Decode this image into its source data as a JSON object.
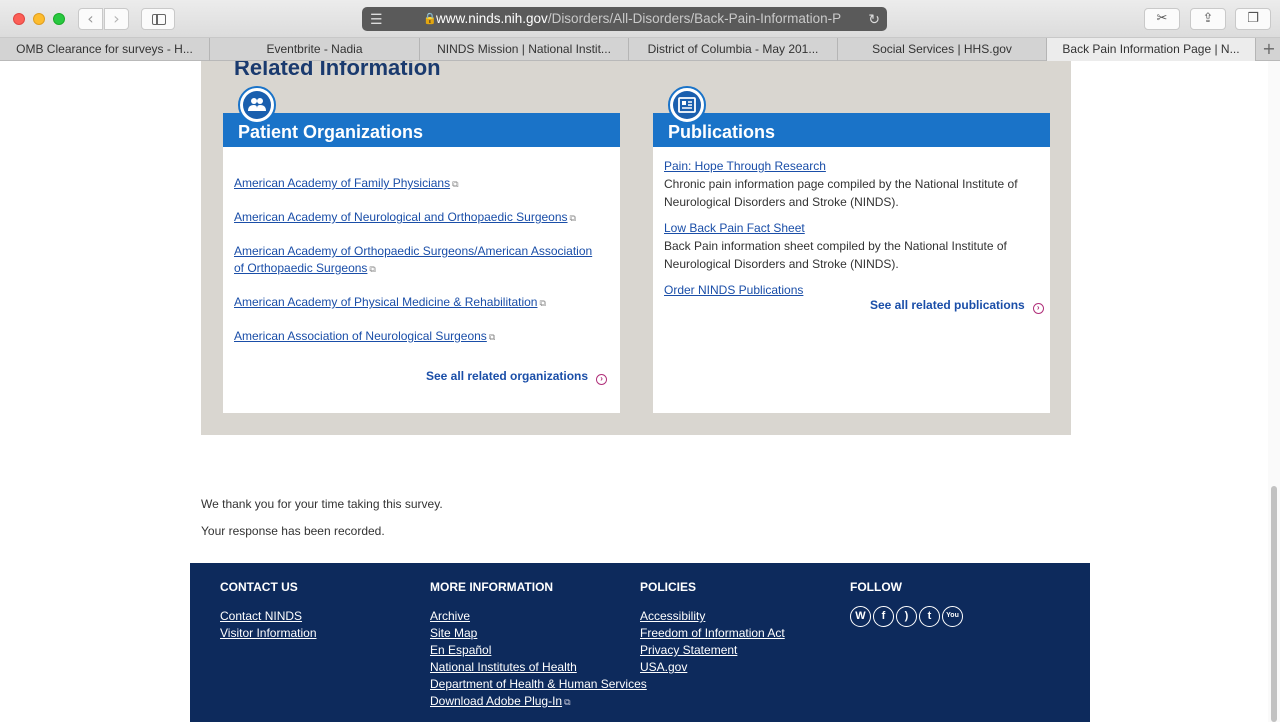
{
  "browser": {
    "url_domain": "www.ninds.nih.gov",
    "url_path": "/Disorders/All-Disorders/Back-Pain-Information-P",
    "tabs": [
      {
        "label": "OMB Clearance for surveys - H..."
      },
      {
        "label": "Eventbrite - Nadia"
      },
      {
        "label": "NINDS Mission | National Instit..."
      },
      {
        "label": "District of Columbia - May 201..."
      },
      {
        "label": "Social Services | HHS.gov"
      },
      {
        "label": "Back Pain Information Page | N..."
      }
    ],
    "new_tab": "+"
  },
  "related": {
    "title": "Related Information",
    "patient_orgs": {
      "title": "Patient Organizations",
      "links": [
        {
          "label": "American Academy of Family Physicians"
        },
        {
          "label": "American Academy of Neurological and Orthopaedic Surgeons"
        },
        {
          "label": "American Academy of Orthopaedic Surgeons/American Association of Orthopaedic Surgeons"
        },
        {
          "label": "American Academy of Physical Medicine & Rehabilitation"
        },
        {
          "label": "American Association of Neurological Surgeons"
        }
      ],
      "see_all": "See all related organizations"
    },
    "publications": {
      "title": "Publications",
      "items": [
        {
          "title": "Pain: Hope Through Research",
          "desc": "Chronic pain information page compiled by the National Institute of Neurological Disorders and Stroke (NINDS)."
        },
        {
          "title": "Low Back Pain Fact Sheet",
          "desc": "Back Pain information sheet compiled by the National Institute of Neurological Disorders and Stroke (NINDS)."
        }
      ],
      "order": "Order NINDS Publications",
      "see_all": "See all related publications"
    }
  },
  "survey": {
    "thanks": "We thank you for your time taking this survey.",
    "recorded": "Your response has been recorded."
  },
  "footer": {
    "contact": {
      "title": "CONTACT US",
      "links": [
        "Contact NINDS",
        "Visitor Information"
      ]
    },
    "more": {
      "title": "MORE INFORMATION",
      "links": [
        "Archive",
        "Site Map",
        "En Español",
        "National Institutes of Health",
        "Department of Health & Human Services",
        "Download Adobe Plug-In"
      ]
    },
    "policies": {
      "title": "POLICIES",
      "links": [
        "Accessibility",
        "Freedom of Information Act",
        "Privacy Statement",
        "USA.gov"
      ]
    },
    "follow": {
      "title": "FOLLOW",
      "icons": [
        "wordpress-icon",
        "facebook-icon",
        "rss-icon",
        "twitter-icon",
        "youtube-icon"
      ]
    }
  },
  "colors": {
    "accent_blue": "#1a73c8",
    "link_blue": "#1a4ea8",
    "heading_navy": "#1a3a6e",
    "footer_navy": "#0d2a5c",
    "panel_gray": "#d9d6d0",
    "arrow_magenta": "#b0307a"
  }
}
